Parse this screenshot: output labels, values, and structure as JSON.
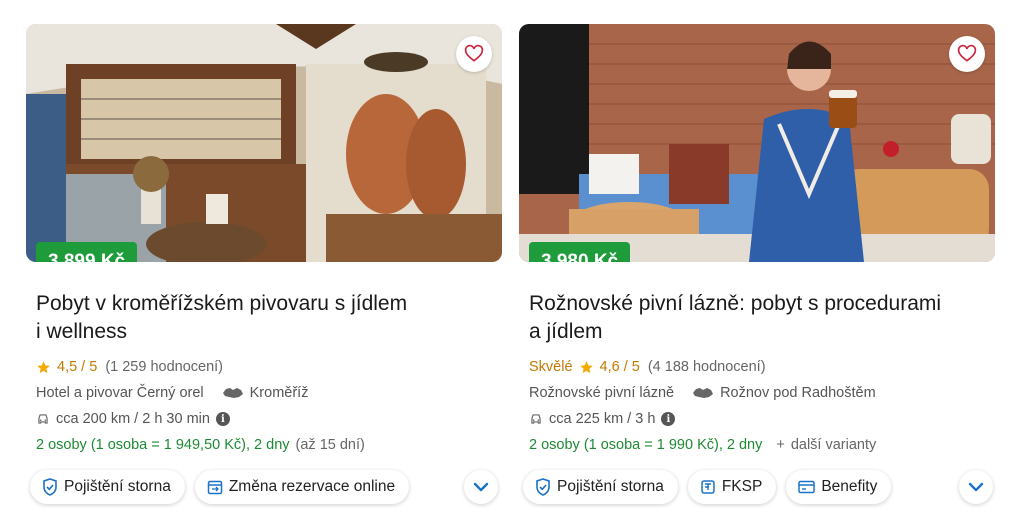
{
  "offers": [
    {
      "image": "brewery-interior-photo",
      "favorite_icon": "heart-outline-icon",
      "price": "3 899 Kč",
      "title_line1": "Pobyt v kroměřížském pivovaru s jídlem",
      "title_line2": "i wellness",
      "quality": "",
      "rating": "4,5 / 5",
      "rating_count": "(1 259 hodnocení)",
      "hotel": "Hotel a pivovar Černý orel",
      "location": "Kroměříž",
      "distance": "cca 200 km / 2 h 30 min",
      "persons": "2 osoby (1 osoba = 1 949,50 Kč), 2 dny",
      "extra": "(až 15 dní)",
      "tags": [
        {
          "icon": "insurance-icon",
          "label": "Pojištění storna"
        },
        {
          "icon": "calendar-change-icon",
          "label": "Změna rezervace online"
        }
      ]
    },
    {
      "image": "beer-spa-photo",
      "favorite_icon": "heart-outline-icon",
      "price": "3 980 Kč",
      "title_line1": "Rožnovské pivní lázně: pobyt s procedurami",
      "title_line2": "a jídlem",
      "quality": "Skvělé",
      "rating": "4,6 / 5",
      "rating_count": "(4 188 hodnocení)",
      "hotel": "Rožnovské pivní lázně",
      "location": "Rožnov pod Radhoštěm",
      "distance": "cca 225 km / 3 h",
      "persons": "2 osoby (1 osoba = 1 990 Kč), 2 dny",
      "extra_plus": "+",
      "extra": "další varianty",
      "tags": [
        {
          "icon": "insurance-icon",
          "label": "Pojištění storna"
        },
        {
          "icon": "fksp-icon",
          "label": "FKSP"
        },
        {
          "icon": "benefit-card-icon",
          "label": "Benefity"
        }
      ]
    }
  ],
  "colors": {
    "price_bg": "#1e9b3a",
    "rating": "#c27a00",
    "green_text": "#1e8a34",
    "accent": "#1a73c9"
  }
}
